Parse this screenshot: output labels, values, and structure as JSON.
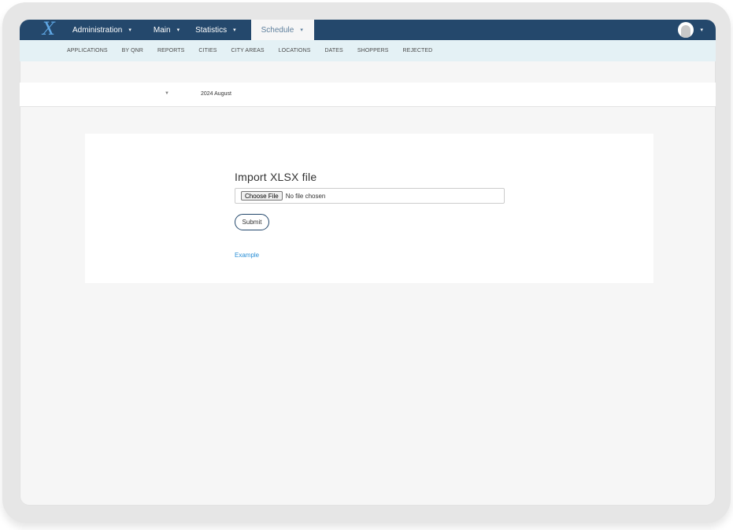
{
  "navbar": {
    "logo": "X",
    "items": [
      {
        "label": "Administration",
        "active": false
      },
      {
        "label": "Main",
        "active": false
      },
      {
        "label": "Statistics",
        "active": false
      },
      {
        "label": "Schedule",
        "active": true
      }
    ],
    "caret": "▾"
  },
  "subnav": {
    "items": [
      "APPLICATIONS",
      "BY QNR",
      "REPORTS",
      "CITIES",
      "CITY AREAS",
      "LOCATIONS",
      "DATES",
      "SHOPPERS",
      "REJECTED"
    ]
  },
  "period": {
    "caret": "▼",
    "label": "2024 August"
  },
  "import_form": {
    "title": "Import XLSX file",
    "choose_file_label": "Choose File",
    "file_status": "No file chosen",
    "submit_label": "Submit",
    "example_link": "Example"
  },
  "icons": {
    "logo": "x-logo-icon",
    "avatar": "user-avatar-icon",
    "caret": "chevron-down-icon"
  },
  "colors": {
    "navbar_bg": "#24486c",
    "subnav_bg": "#e4f1f5",
    "active_tab_text": "#5d7f9c",
    "link": "#2a8fd6",
    "logo": "#5fa8e6"
  }
}
